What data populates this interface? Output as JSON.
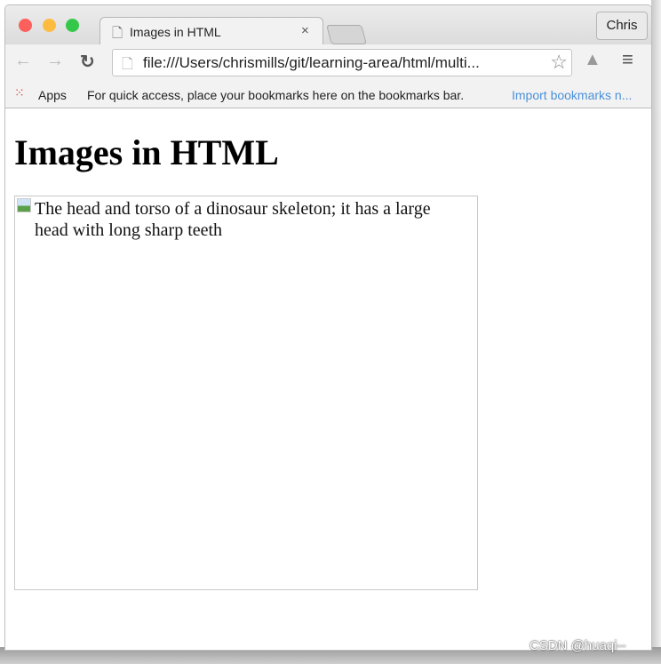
{
  "browser": {
    "tab_title": "Images in HTML",
    "tab_close": "×",
    "profile": "Chris",
    "url": "file:///Users/chrismills/git/learning-area/html/multi...",
    "bookmarks": {
      "apps": "Apps",
      "hint": "For quick access, place your bookmarks here on the bookmarks bar.",
      "import": "Import bookmarks n..."
    },
    "colors": {
      "close": "#fc605c",
      "minimize": "#fdbc40",
      "zoom": "#34c84a",
      "link": "#4a90d9"
    }
  },
  "page": {
    "heading": "Images in HTML",
    "image_alt": "The head and torso of a dinosaur skeleton; it has a large head with long sharp teeth"
  },
  "watermark": "CSDN @huaqi--"
}
